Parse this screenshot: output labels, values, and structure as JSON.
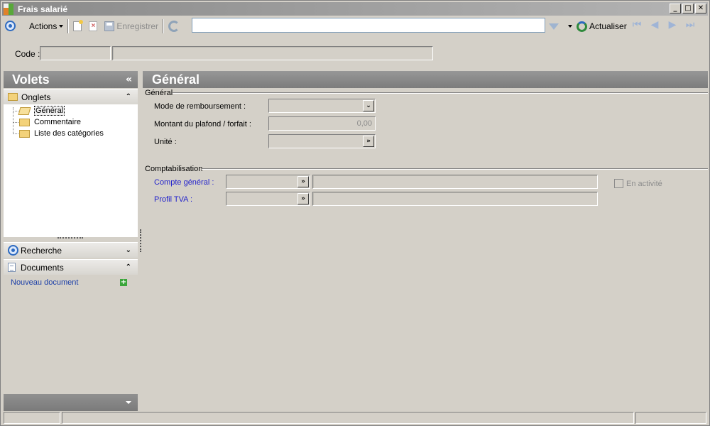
{
  "window": {
    "title": "Frais salarié"
  },
  "toolbar": {
    "actions_label": "Actions",
    "save_label": "Enregistrer",
    "search_value": "",
    "refresh_label": "Actualiser"
  },
  "code_row": {
    "label": "Code :",
    "code_value": "",
    "name_value": ""
  },
  "left_panel": {
    "title": "Volets",
    "tabs_group": {
      "label": "Onglets",
      "items": [
        {
          "label": "Général",
          "selected": true
        },
        {
          "label": "Commentaire",
          "selected": false
        },
        {
          "label": "Liste des catégories",
          "selected": false
        }
      ]
    },
    "search_group": {
      "label": "Recherche"
    },
    "documents_group": {
      "label": "Documents",
      "new_document_link": "Nouveau document"
    }
  },
  "main": {
    "title": "Général",
    "general_section": {
      "title": "Général",
      "reimbursement_mode_label": "Mode de remboursement :",
      "reimbursement_mode_value": "",
      "ceiling_amount_label": "Montant du plafond / forfait :",
      "ceiling_amount_value": "0,00",
      "unit_label": "Unité :",
      "unit_value": ""
    },
    "accounting_section": {
      "title": "Comptabilisation",
      "general_account_label": "Compte général :",
      "vat_profile_label": "Profil TVA :",
      "active_label": "En activité",
      "active_checked": false
    }
  },
  "colors": {
    "header_gray": "#8a8a8a",
    "link_blue": "#2222cc",
    "face": "#d4d0c8"
  }
}
